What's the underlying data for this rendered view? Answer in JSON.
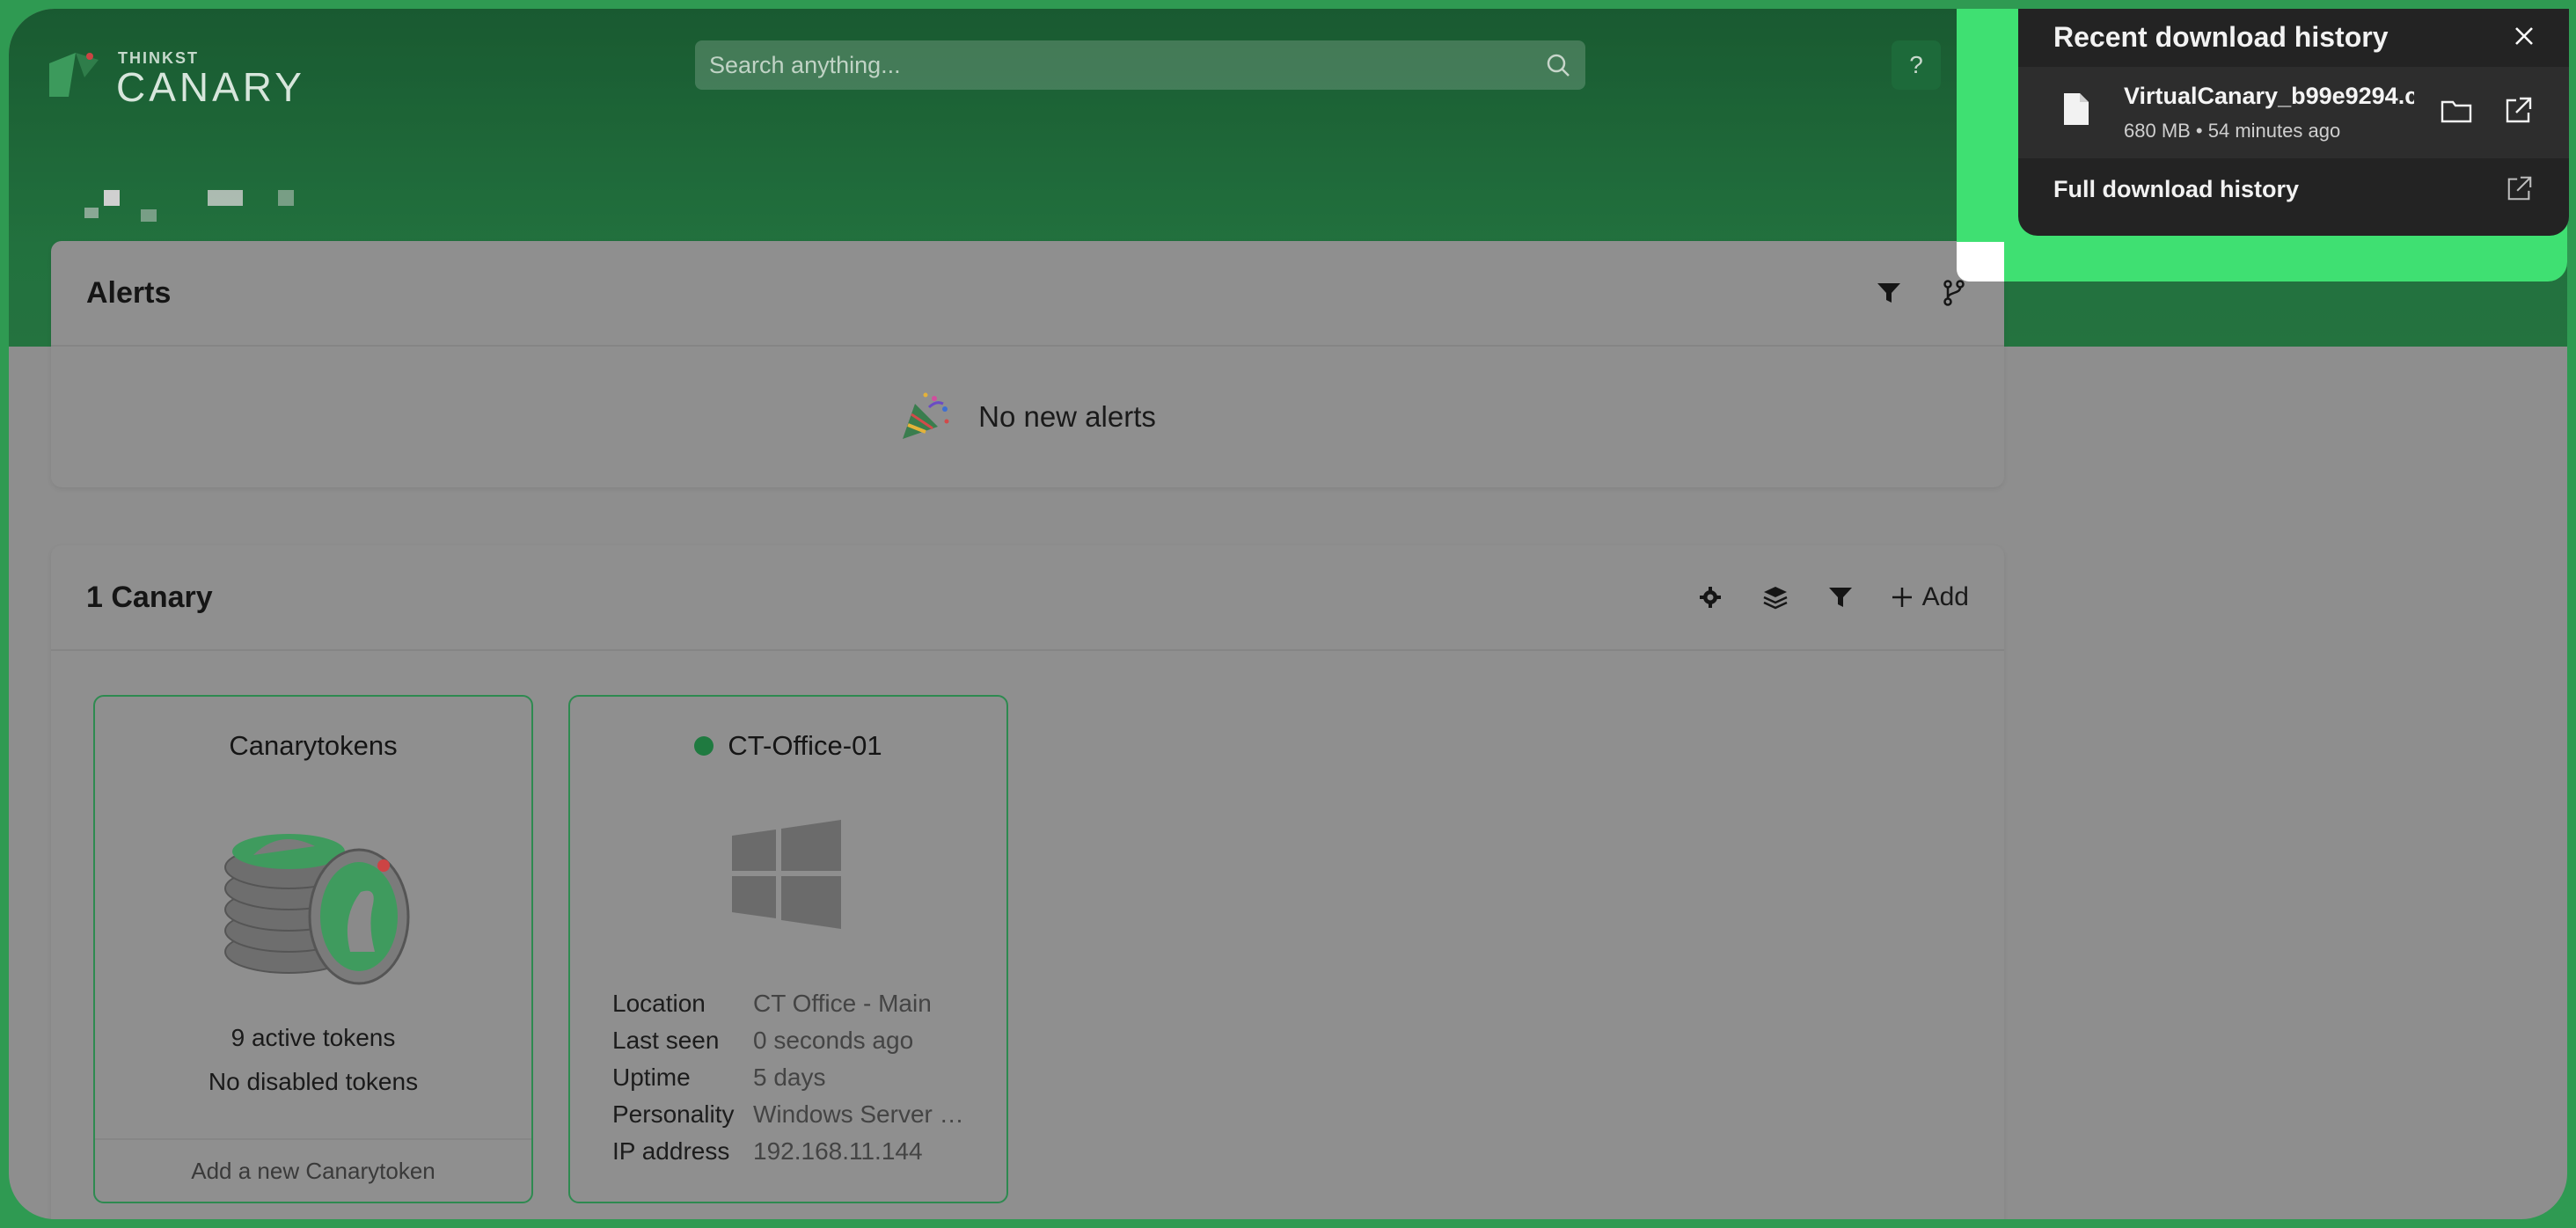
{
  "header": {
    "logo_small": "THINKST",
    "logo_big": "CANARY",
    "search_placeholder": "Search anything...",
    "help_label": "?"
  },
  "alerts": {
    "title": "Alerts",
    "empty_text": "No new alerts"
  },
  "canaries": {
    "title": "1 Canary",
    "add_label": "Add",
    "tokens_tile": {
      "title": "Canarytokens",
      "active": "9 active tokens",
      "disabled": "No disabled tokens",
      "footer": "Add a new Canarytoken"
    },
    "device_tile": {
      "name": "CT-Office-01",
      "status_color": "#1f7a40",
      "os_icon": "windows-logo-icon",
      "info": [
        {
          "key": "Location",
          "value": "CT Office - Main"
        },
        {
          "key": "Last seen",
          "value": "0 seconds ago"
        },
        {
          "key": "Uptime",
          "value": "5 days"
        },
        {
          "key": "Personality",
          "value": "Windows Server …"
        },
        {
          "key": "IP address",
          "value": "192.168.11.144"
        }
      ]
    }
  },
  "downloads": {
    "title": "Recent download history",
    "item": {
      "name": "VirtualCanary_b99e9294.c",
      "meta": "680 MB • 54 minutes ago"
    },
    "full_history": "Full download history"
  },
  "colors": {
    "brand_green": "#2f9a52",
    "highlight_green": "#3fe072",
    "popover_bg": "#232323"
  }
}
